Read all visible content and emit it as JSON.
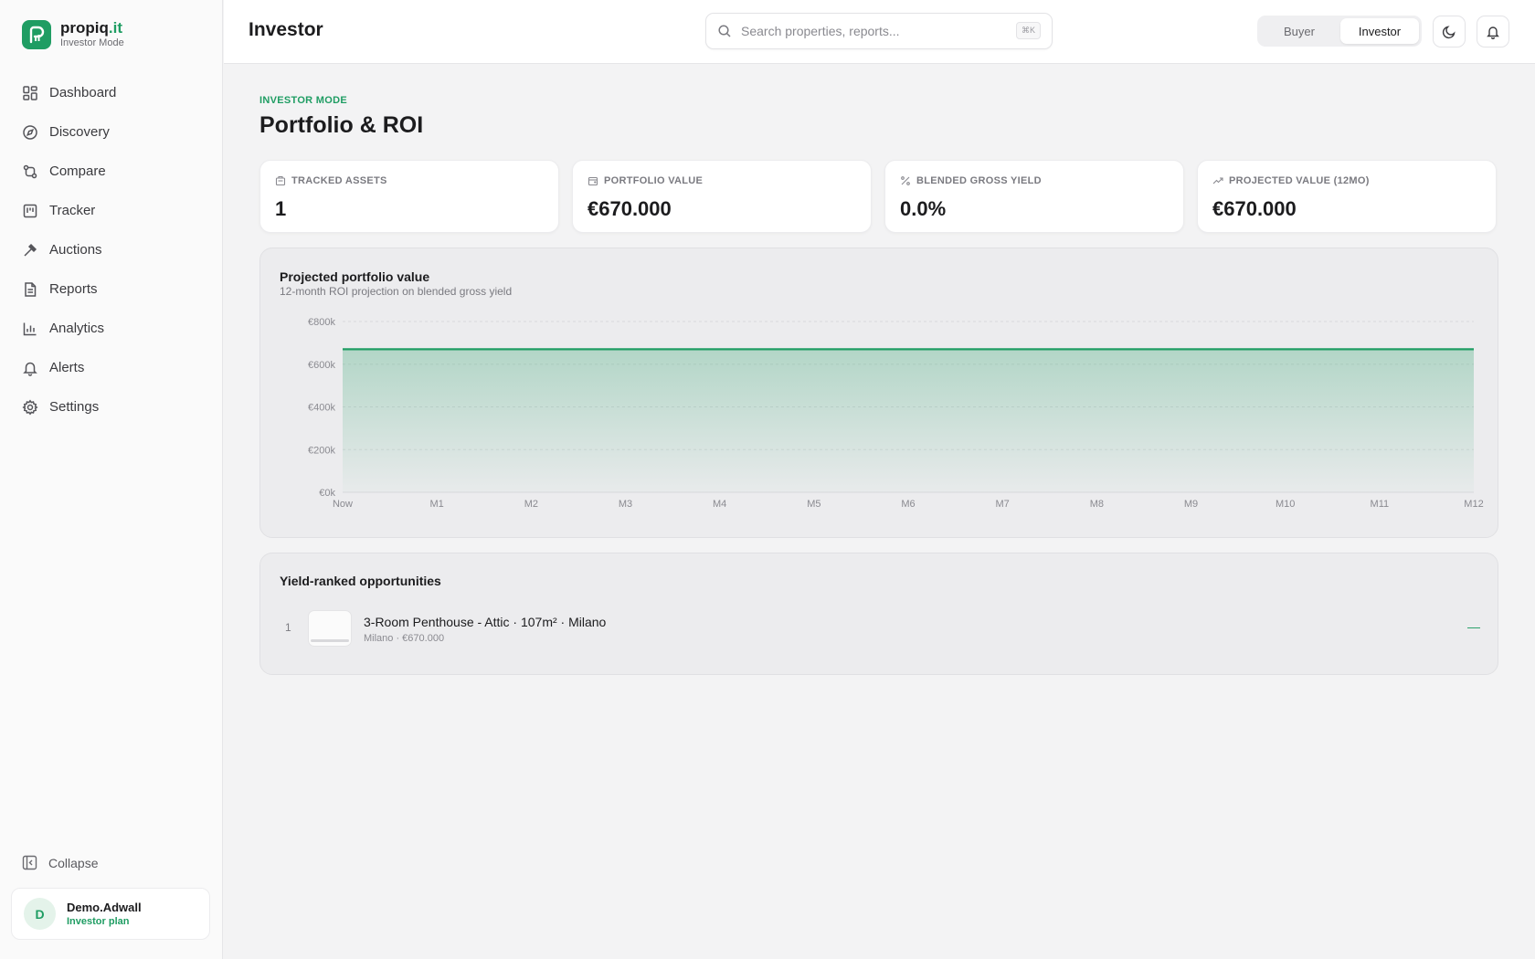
{
  "brand": {
    "name": "propiq",
    "tld": ".it",
    "subtitle": "Investor Mode"
  },
  "sidebar": {
    "items": [
      {
        "label": "Dashboard",
        "icon": "grid-icon"
      },
      {
        "label": "Discovery",
        "icon": "compass-icon"
      },
      {
        "label": "Compare",
        "icon": "compare-icon"
      },
      {
        "label": "Tracker",
        "icon": "kanban-icon"
      },
      {
        "label": "Auctions",
        "icon": "gavel-icon"
      },
      {
        "label": "Reports",
        "icon": "document-icon"
      },
      {
        "label": "Analytics",
        "icon": "bar-chart-icon"
      },
      {
        "label": "Alerts",
        "icon": "bell-icon"
      },
      {
        "label": "Settings",
        "icon": "gear-icon"
      }
    ],
    "collapse_label": "Collapse"
  },
  "user": {
    "initial": "D",
    "name": "Demo.Adwall",
    "plan": "Investor plan"
  },
  "header": {
    "title": "Investor",
    "search_placeholder": "Search properties, reports...",
    "shortcut": "⌘K",
    "modes": [
      "Buyer",
      "Investor"
    ],
    "active_mode": "Investor"
  },
  "page": {
    "eyebrow": "INVESTOR MODE",
    "title": "Portfolio & ROI"
  },
  "stats": [
    {
      "label": "TRACKED ASSETS",
      "value": "1",
      "icon": "building-icon"
    },
    {
      "label": "PORTFOLIO VALUE",
      "value": "€670.000",
      "icon": "wallet-icon"
    },
    {
      "label": "BLENDED GROSS YIELD",
      "value": "0.0%",
      "icon": "percent-icon"
    },
    {
      "label": "PROJECTED VALUE (12MO)",
      "value": "€670.000",
      "icon": "trending-up-icon"
    }
  ],
  "chart": {
    "title": "Projected portfolio value",
    "subtitle": "12-month ROI projection on blended gross yield"
  },
  "chart_data": {
    "type": "area",
    "x": [
      "Now",
      "M1",
      "M2",
      "M3",
      "M4",
      "M5",
      "M6",
      "M7",
      "M8",
      "M9",
      "M10",
      "M11",
      "M12"
    ],
    "series": [
      {
        "values": [
          670000,
          670000,
          670000,
          670000,
          670000,
          670000,
          670000,
          670000,
          670000,
          670000,
          670000,
          670000,
          670000
        ]
      }
    ],
    "yticks": [
      "€0k",
      "€200k",
      "€400k",
      "€600k",
      "€800k"
    ],
    "ylim": [
      0,
      800000
    ],
    "grid": true,
    "color": "#1f9d63"
  },
  "opportunities": {
    "title": "Yield-ranked opportunities",
    "items": [
      {
        "rank": "1",
        "name": "3-Room Penthouse - Attic · 107m² · Milano",
        "meta": "Milano · €670.000",
        "yield": "—"
      }
    ]
  },
  "colors": {
    "accent": "#1f9d63",
    "background": "#f3f3f4"
  }
}
